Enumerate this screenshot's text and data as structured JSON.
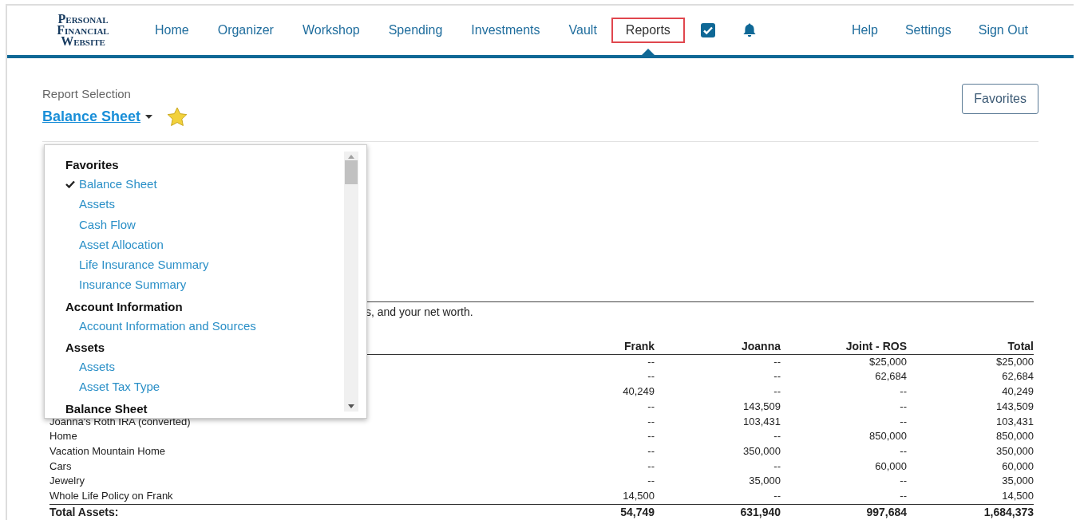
{
  "logo": {
    "lines": [
      "Personal",
      "Financial",
      "Website"
    ]
  },
  "nav": [
    {
      "label": "Home",
      "selected": false
    },
    {
      "label": "Organizer",
      "selected": false
    },
    {
      "label": "Workshop",
      "selected": false
    },
    {
      "label": "Spending",
      "selected": false
    },
    {
      "label": "Investments",
      "selected": false
    },
    {
      "label": "Vault",
      "selected": false
    },
    {
      "label": "Reports",
      "selected": true
    }
  ],
  "nav_right": [
    "Help",
    "Settings",
    "Sign Out"
  ],
  "report_selection": {
    "label": "Report Selection",
    "value": "Balance Sheet",
    "favorite": true
  },
  "favorites_button": "Favorites",
  "dropdown": {
    "groups": [
      {
        "heading": "Favorites",
        "items": [
          {
            "label": "Balance Sheet",
            "selected": true
          },
          {
            "label": "Assets",
            "selected": false
          },
          {
            "label": "Cash Flow",
            "selected": false
          },
          {
            "label": "Asset Allocation",
            "selected": false
          },
          {
            "label": "Life Insurance Summary",
            "selected": false
          },
          {
            "label": "Insurance Summary",
            "selected": false
          }
        ]
      },
      {
        "heading": "Account Information",
        "items": [
          {
            "label": "Account Information and Sources",
            "selected": false
          }
        ]
      },
      {
        "heading": "Assets",
        "items": [
          {
            "label": "Assets",
            "selected": false
          },
          {
            "label": "Asset Tax Type",
            "selected": false
          }
        ]
      },
      {
        "heading": "Balance Sheet"
      }
    ]
  },
  "description": "s, and your net worth.",
  "table": {
    "columns": [
      "Frank",
      "Joanna",
      "Joint - ROS",
      "Total"
    ],
    "rows": [
      {
        "kind": "item",
        "values": [
          "--",
          "--",
          "$25,000",
          "$25,000"
        ]
      },
      {
        "kind": "item",
        "values": [
          "--",
          "--",
          "62,684",
          "62,684"
        ]
      },
      {
        "kind": "item",
        "values": [
          "40,249",
          "--",
          "--",
          "40,249"
        ]
      },
      {
        "kind": "item",
        "values": [
          "--",
          "143,509",
          "--",
          "143,509"
        ]
      },
      {
        "kind": "item",
        "label": "Joanna's Roth IRA (converted)",
        "values": [
          "--",
          "103,431",
          "--",
          "103,431"
        ]
      },
      {
        "kind": "item",
        "label": "Home",
        "values": [
          "--",
          "--",
          "850,000",
          "850,000"
        ]
      },
      {
        "kind": "item",
        "label": "Vacation Mountain Home",
        "values": [
          "--",
          "350,000",
          "--",
          "350,000"
        ]
      },
      {
        "kind": "item",
        "label": "Cars",
        "values": [
          "--",
          "--",
          "60,000",
          "60,000"
        ]
      },
      {
        "kind": "item",
        "label": "Jewelry",
        "values": [
          "--",
          "35,000",
          "--",
          "35,000"
        ]
      },
      {
        "kind": "item",
        "label": "Whole Life Policy on Frank",
        "values": [
          "14,500",
          "--",
          "--",
          "14,500"
        ]
      },
      {
        "kind": "total",
        "label": "Total Assets:",
        "values": [
          "54,749",
          "631,940",
          "997,684",
          "1,684,373"
        ]
      }
    ]
  }
}
